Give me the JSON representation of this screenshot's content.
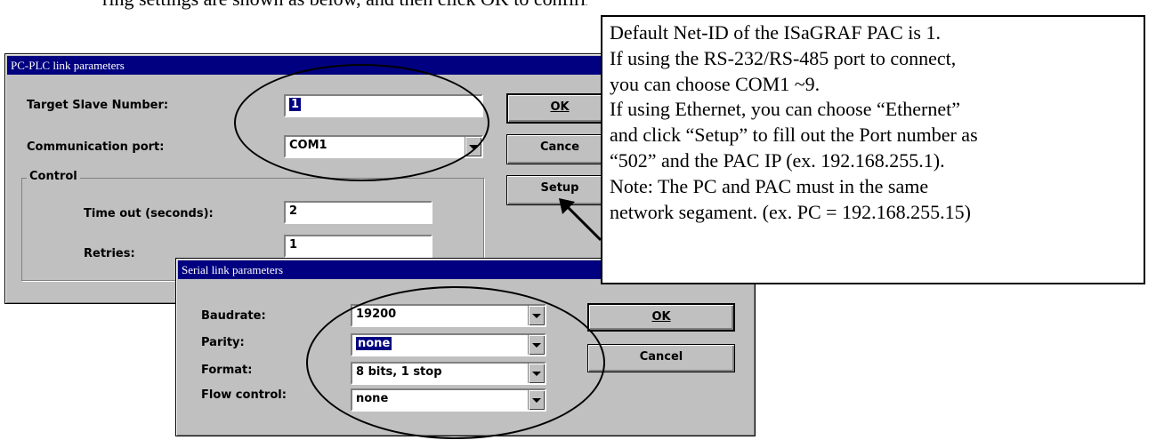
{
  "intro_text": "ring settings are shown as below, and then click OK to confirm it.",
  "plc_dialog": {
    "title": "PC-PLC link parameters",
    "target_slave_label": "Target Slave Number:",
    "target_slave_value": "1",
    "comm_port_label": "Communication port:",
    "comm_port_value": "COM1",
    "control_group_label": "Control",
    "timeout_label": "Time out (seconds):",
    "timeout_value": "2",
    "retries_label": "Retries:",
    "retries_value": "1",
    "ok_label": "OK",
    "cancel_label": "Cance",
    "setup_label": "Setup"
  },
  "serial_dialog": {
    "title": "Serial link parameters",
    "baudrate_label": "Baudrate:",
    "baudrate_value": "19200",
    "parity_label": "Parity:",
    "parity_value": "none",
    "format_label": "Format:",
    "format_value": "8 bits, 1 stop",
    "flow_label": "Flow control:",
    "flow_value": "none",
    "ok_label": "OK",
    "cancel_label": "Cancel"
  },
  "note_lines": [
    "Default Net-ID of the ISaGRAF PAC is 1.",
    "If using the RS-232/RS-485 port to connect,",
    "you can choose COM1 ~9.",
    "If using Ethernet, you can choose “Ethernet”",
    "and click “Setup” to fill out the Port number as",
    "“502” and the PAC IP (ex. 192.168.255.1).",
    "Note: The PC and PAC must in the same",
    "network segament. (ex. PC = 192.168.255.15)"
  ]
}
